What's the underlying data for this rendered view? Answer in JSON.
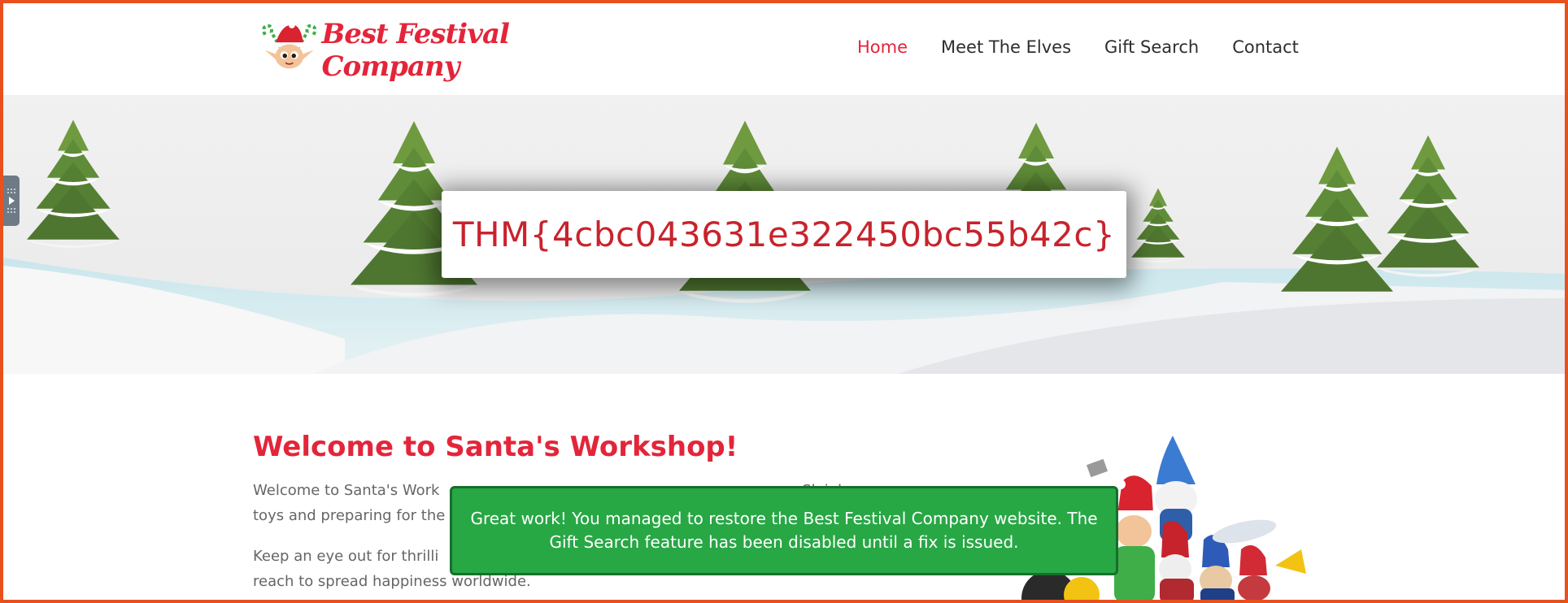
{
  "header": {
    "logo_text": "Best Festival Company",
    "nav": [
      {
        "label": "Home",
        "active": true
      },
      {
        "label": "Meet The Elves",
        "active": false
      },
      {
        "label": "Gift Search",
        "active": false
      },
      {
        "label": "Contact",
        "active": false
      }
    ]
  },
  "hero": {
    "flag": "THM{4cbc043631e322450bc55b42c}"
  },
  "main": {
    "title": "Welcome to Santa's Workshop!",
    "para1_line1": "Welcome to Santa's Work",
    "para1_line2_start": "toys and preparing for the",
    "para1_line1_end": "Sleigh",
    "para2_line1_start": "Keep an eye out for thrilli",
    "para2_line2": "reach to spread happiness worldwide."
  },
  "toast": {
    "message": "Great work! You managed to restore the Best Festival Company website. The Gift Search feature has been disabled until a fix is issued."
  },
  "colors": {
    "accent": "#e3253a",
    "flag": "#c8232c",
    "toast": "#28a745",
    "frame": "#e8501e"
  },
  "icons": {
    "logo": "elf-logo-icon",
    "side_tab": "play-tab-icon"
  }
}
